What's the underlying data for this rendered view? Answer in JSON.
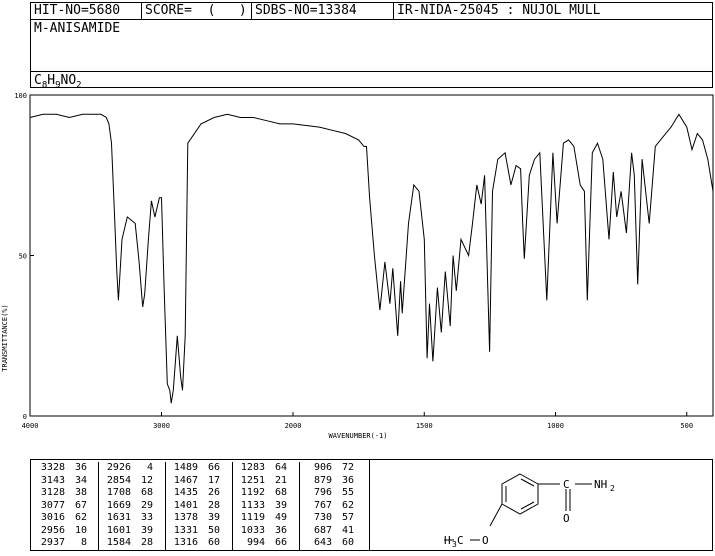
{
  "header": {
    "hit_no": "HIT-NO=5680",
    "score": "SCORE=  (   )",
    "sdbs_no": "SDBS-NO=13384",
    "ir_info": "IR-NIDA-25045 : NUJOL MULL",
    "compound": "M-ANISAMIDE",
    "formula": {
      "c": "C",
      "c_n": "8",
      "h": "H",
      "h_n": "9",
      "rest": "NO",
      "o_n": "2"
    }
  },
  "chart_data": {
    "type": "line",
    "xlabel": "WAVENUMBER(-1)",
    "ylabel": "TRANSMITTANCE(%)",
    "xlim": [
      4000,
      400
    ],
    "ylim": [
      0,
      100
    ],
    "x_ticks": [
      "4000",
      "3000",
      "2000",
      "1500",
      "1000",
      "500"
    ],
    "y_ticks": [
      "100",
      "50",
      "0"
    ],
    "grid": false,
    "series": [
      {
        "x": [
          4000,
          3900,
          3800,
          3700,
          3600,
          3500,
          3460,
          3420,
          3400,
          3380,
          3360,
          3340,
          3328,
          3300,
          3260,
          3200,
          3170,
          3143,
          3128,
          3100,
          3077,
          3050,
          3016,
          3000,
          2980,
          2956,
          2937,
          2926,
          2910,
          2880,
          2854,
          2840,
          2820,
          2800,
          2700,
          2600,
          2500,
          2400,
          2300,
          2200,
          2100,
          2000,
          1900,
          1850,
          1800,
          1750,
          1740,
          1730,
          1720,
          1708,
          1690,
          1669,
          1650,
          1631,
          1620,
          1601,
          1590,
          1584,
          1560,
          1540,
          1520,
          1500,
          1489,
          1480,
          1467,
          1450,
          1435,
          1420,
          1401,
          1390,
          1378,
          1360,
          1331,
          1316,
          1300,
          1283,
          1270,
          1251,
          1240,
          1220,
          1192,
          1170,
          1150,
          1133,
          1125,
          1119,
          1100,
          1080,
          1060,
          1033,
          1010,
          994,
          970,
          950,
          930,
          906,
          890,
          879,
          860,
          840,
          820,
          796,
          780,
          767,
          750,
          730,
          710,
          700,
          687,
          670,
          643,
          620,
          600,
          560,
          530,
          500,
          480,
          460,
          440,
          420,
          400
        ],
        "y": [
          93,
          94,
          94,
          93,
          94,
          94,
          94,
          93,
          91,
          85,
          65,
          45,
          36,
          55,
          62,
          60,
          48,
          34,
          38,
          55,
          67,
          62,
          68,
          68,
          40,
          10,
          8,
          4,
          8,
          25,
          12,
          8,
          25,
          85,
          91,
          93,
          94,
          93,
          93,
          92,
          91,
          91,
          90,
          89,
          88,
          86,
          85,
          84,
          84,
          68,
          50,
          33,
          48,
          35,
          46,
          25,
          42,
          32,
          60,
          72,
          70,
          55,
          18,
          35,
          17,
          40,
          26,
          45,
          28,
          50,
          39,
          55,
          50,
          60,
          72,
          66,
          75,
          20,
          70,
          80,
          82,
          72,
          78,
          77,
          60,
          49,
          75,
          80,
          82,
          36,
          82,
          60,
          85,
          86,
          84,
          72,
          70,
          36,
          82,
          85,
          80,
          55,
          76,
          62,
          70,
          57,
          82,
          75,
          41,
          80,
          60,
          84,
          86,
          90,
          94,
          90,
          83,
          88,
          86,
          80,
          70
        ]
      }
    ]
  },
  "peaks": [
    [
      {
        "w": "3328",
        "t": "36"
      },
      {
        "w": "3143",
        "t": "34"
      },
      {
        "w": "3128",
        "t": "38"
      },
      {
        "w": "3077",
        "t": "67"
      },
      {
        "w": "3016",
        "t": "62"
      },
      {
        "w": "2956",
        "t": "10"
      },
      {
        "w": "2937",
        "t": "8"
      }
    ],
    [
      {
        "w": "2926",
        "t": "4"
      },
      {
        "w": "2854",
        "t": "12"
      },
      {
        "w": "1708",
        "t": "68"
      },
      {
        "w": "1669",
        "t": "29"
      },
      {
        "w": "1631",
        "t": "33"
      },
      {
        "w": "1601",
        "t": "39"
      },
      {
        "w": "1584",
        "t": "28"
      }
    ],
    [
      {
        "w": "1489",
        "t": "66"
      },
      {
        "w": "1467",
        "t": "17"
      },
      {
        "w": "1435",
        "t": "26"
      },
      {
        "w": "1401",
        "t": "28"
      },
      {
        "w": "1378",
        "t": "39"
      },
      {
        "w": "1331",
        "t": "50"
      },
      {
        "w": "1316",
        "t": "60"
      }
    ],
    [
      {
        "w": "1283",
        "t": "64"
      },
      {
        "w": "1251",
        "t": "21"
      },
      {
        "w": "1192",
        "t": "68"
      },
      {
        "w": "1133",
        "t": "39"
      },
      {
        "w": "1119",
        "t": "49"
      },
      {
        "w": "1033",
        "t": "36"
      },
      {
        "w": "994",
        "t": "66"
      }
    ],
    [
      {
        "w": "906",
        "t": "72"
      },
      {
        "w": "879",
        "t": "36"
      },
      {
        "w": "796",
        "t": "55"
      },
      {
        "w": "767",
        "t": "62"
      },
      {
        "w": "730",
        "t": "57"
      },
      {
        "w": "687",
        "t": "41"
      },
      {
        "w": "643",
        "t": "60"
      }
    ]
  ],
  "structure": {
    "carbonyl_c": "C",
    "amide": "NH",
    "amide_sub": "2",
    "oxygen": "O",
    "methoxy_h3c": "H",
    "methoxy_sub": "3",
    "methoxy_c": "C",
    "methoxy_o": "O"
  }
}
